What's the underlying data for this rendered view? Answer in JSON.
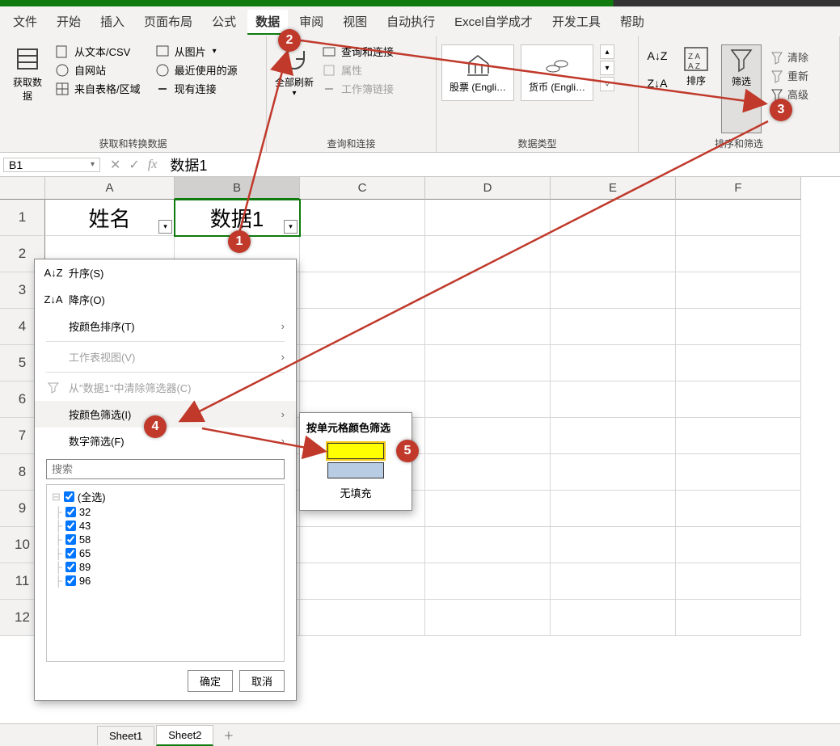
{
  "menus": [
    "文件",
    "开始",
    "插入",
    "页面布局",
    "公式",
    "数据",
    "审阅",
    "视图",
    "自动执行",
    "Excel自学成才",
    "开发工具",
    "帮助"
  ],
  "active_menu_index": 5,
  "ribbon": {
    "group1": {
      "get_data": "获取数\n据",
      "items": [
        "从文本/CSV",
        "自网站",
        "来自表格/区域"
      ],
      "label": "获取和转换数据"
    },
    "group1b": {
      "items": [
        "从图片",
        "最近使用的源",
        "现有连接"
      ]
    },
    "group2": {
      "refresh": "全部刷新",
      "items": [
        "查询和连接",
        "属性",
        "工作簿链接"
      ],
      "label": "查询和连接"
    },
    "group3": {
      "stock": "股票 (Engli…",
      "currency": "货币 (Engli…",
      "label": "数据类型"
    },
    "group4": {
      "sort": "排序",
      "filter": "筛选",
      "side": [
        "清除",
        "重新",
        "高级"
      ],
      "label": "排序和筛选"
    }
  },
  "namebox": "B1",
  "formula": "数据1",
  "columns": [
    "A",
    "B",
    "C",
    "D",
    "E",
    "F"
  ],
  "row_numbers": [
    "1",
    "2",
    "3",
    "4",
    "5",
    "6",
    "7",
    "8",
    "9",
    "10",
    "11",
    "12"
  ],
  "A1": "姓名",
  "B1": "数据1",
  "filter_menu": {
    "asc": "升序(S)",
    "desc": "降序(O)",
    "sort_color": "按颜色排序(T)",
    "sheet_view": "工作表视图(V)",
    "clear": "从\"数据1\"中清除筛选器(C)",
    "filter_color": "按颜色筛选(I)",
    "number_filter": "数字筛选(F)",
    "search_ph": "搜索",
    "all": "(全选)",
    "vals": [
      "32",
      "43",
      "58",
      "65",
      "89",
      "96"
    ],
    "ok": "确定",
    "cancel": "取消"
  },
  "color_submenu": {
    "title": "按单元格颜色筛选",
    "colors": [
      "#ffff00",
      "#b8cce4"
    ],
    "nofill": "无填充"
  },
  "sheets": [
    "Sheet1",
    "Sheet2"
  ],
  "active_sheet": 1,
  "badges": [
    "1",
    "2",
    "3",
    "4",
    "5"
  ],
  "chart_data": null
}
